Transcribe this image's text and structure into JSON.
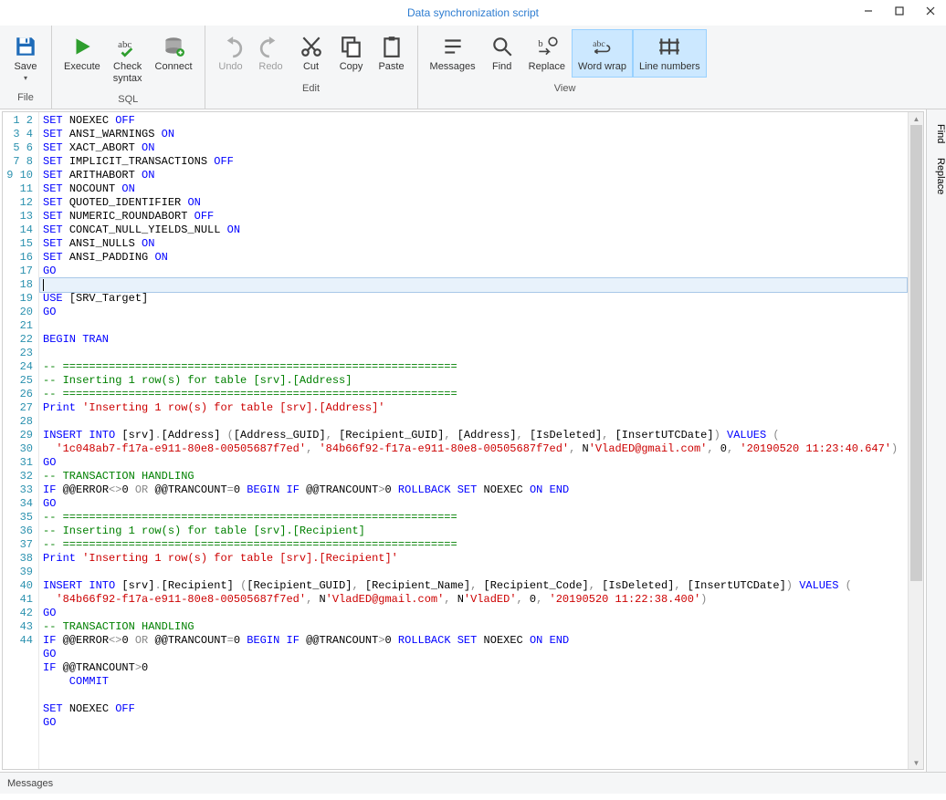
{
  "window": {
    "title": "Data synchronization script"
  },
  "ribbon": {
    "groups": {
      "file": {
        "label": "File",
        "save": "Save"
      },
      "sql": {
        "label": "SQL",
        "execute": "Execute",
        "check": "Check\nsyntax",
        "connect": "Connect"
      },
      "edit": {
        "label": "Edit",
        "undo": "Undo",
        "redo": "Redo",
        "cut": "Cut",
        "copy": "Copy",
        "paste": "Paste"
      },
      "view": {
        "label": "View",
        "messages": "Messages",
        "find": "Find",
        "replace": "Replace",
        "wrap": "Word wrap",
        "lines": "Line numbers"
      }
    }
  },
  "side": {
    "find": "Find",
    "replace": "Replace"
  },
  "status": {
    "messages": "Messages"
  },
  "code": {
    "lines": [
      {
        "n": 1,
        "tokens": [
          {
            "t": "SET ",
            "c": "kw"
          },
          {
            "t": "NOEXEC ",
            "c": "id"
          },
          {
            "t": "OFF",
            "c": "kw"
          }
        ]
      },
      {
        "n": 2,
        "tokens": [
          {
            "t": "SET ",
            "c": "kw"
          },
          {
            "t": "ANSI_WARNINGS ",
            "c": "id"
          },
          {
            "t": "ON",
            "c": "kw"
          }
        ]
      },
      {
        "n": 3,
        "tokens": [
          {
            "t": "SET ",
            "c": "kw"
          },
          {
            "t": "XACT_ABORT ",
            "c": "id"
          },
          {
            "t": "ON",
            "c": "kw"
          }
        ]
      },
      {
        "n": 4,
        "tokens": [
          {
            "t": "SET ",
            "c": "kw"
          },
          {
            "t": "IMPLICIT_TRANSACTIONS ",
            "c": "id"
          },
          {
            "t": "OFF",
            "c": "kw"
          }
        ]
      },
      {
        "n": 5,
        "tokens": [
          {
            "t": "SET ",
            "c": "kw"
          },
          {
            "t": "ARITHABORT ",
            "c": "id"
          },
          {
            "t": "ON",
            "c": "kw"
          }
        ]
      },
      {
        "n": 6,
        "tokens": [
          {
            "t": "SET ",
            "c": "kw"
          },
          {
            "t": "NOCOUNT ",
            "c": "id"
          },
          {
            "t": "ON",
            "c": "kw"
          }
        ]
      },
      {
        "n": 7,
        "tokens": [
          {
            "t": "SET ",
            "c": "kw"
          },
          {
            "t": "QUOTED_IDENTIFIER ",
            "c": "id"
          },
          {
            "t": "ON",
            "c": "kw"
          }
        ]
      },
      {
        "n": 8,
        "tokens": [
          {
            "t": "SET ",
            "c": "kw"
          },
          {
            "t": "NUMERIC_ROUNDABORT ",
            "c": "id"
          },
          {
            "t": "OFF",
            "c": "kw"
          }
        ]
      },
      {
        "n": 9,
        "tokens": [
          {
            "t": "SET ",
            "c": "kw"
          },
          {
            "t": "CONCAT_NULL_YIELDS_NULL ",
            "c": "id"
          },
          {
            "t": "ON",
            "c": "kw"
          }
        ]
      },
      {
        "n": 10,
        "tokens": [
          {
            "t": "SET ",
            "c": "kw"
          },
          {
            "t": "ANSI_NULLS ",
            "c": "id"
          },
          {
            "t": "ON",
            "c": "kw"
          }
        ]
      },
      {
        "n": 11,
        "tokens": [
          {
            "t": "SET ",
            "c": "kw"
          },
          {
            "t": "ANSI_PADDING ",
            "c": "id"
          },
          {
            "t": "ON",
            "c": "kw"
          }
        ]
      },
      {
        "n": 12,
        "tokens": [
          {
            "t": "GO",
            "c": "kw"
          }
        ]
      },
      {
        "n": 13,
        "selected": true,
        "tokens": []
      },
      {
        "n": 14,
        "tokens": [
          {
            "t": "USE ",
            "c": "kw"
          },
          {
            "t": "[SRV_Target]",
            "c": "id"
          }
        ]
      },
      {
        "n": 15,
        "tokens": [
          {
            "t": "GO",
            "c": "kw"
          }
        ]
      },
      {
        "n": 16,
        "tokens": []
      },
      {
        "n": 17,
        "tokens": [
          {
            "t": "BEGIN TRAN",
            "c": "kw"
          }
        ]
      },
      {
        "n": 18,
        "tokens": []
      },
      {
        "n": 19,
        "tokens": [
          {
            "t": "-- ============================================================",
            "c": "cmt"
          }
        ]
      },
      {
        "n": 20,
        "tokens": [
          {
            "t": "-- Inserting 1 row(s) for table [srv].[Address]",
            "c": "cmt"
          }
        ]
      },
      {
        "n": 21,
        "tokens": [
          {
            "t": "-- ============================================================",
            "c": "cmt"
          }
        ]
      },
      {
        "n": 22,
        "tokens": [
          {
            "t": "Print ",
            "c": "kw"
          },
          {
            "t": "'Inserting 1 row(s) for table [srv].[Address]'",
            "c": "str"
          }
        ]
      },
      {
        "n": 23,
        "tokens": []
      },
      {
        "n": 24,
        "tokens": [
          {
            "t": "INSERT INTO ",
            "c": "kw"
          },
          {
            "t": "[srv]",
            "c": "id"
          },
          {
            "t": ".",
            "c": "gray"
          },
          {
            "t": "[Address] ",
            "c": "id"
          },
          {
            "t": "(",
            "c": "gray"
          },
          {
            "t": "[Address_GUID]",
            "c": "id"
          },
          {
            "t": ", ",
            "c": "gray"
          },
          {
            "t": "[Recipient_GUID]",
            "c": "id"
          },
          {
            "t": ", ",
            "c": "gray"
          },
          {
            "t": "[Address]",
            "c": "id"
          },
          {
            "t": ", ",
            "c": "gray"
          },
          {
            "t": "[IsDeleted]",
            "c": "id"
          },
          {
            "t": ", ",
            "c": "gray"
          },
          {
            "t": "[InsertUTCDate]",
            "c": "id"
          },
          {
            "t": ") ",
            "c": "gray"
          },
          {
            "t": "VALUES ",
            "c": "kw"
          },
          {
            "t": "(",
            "c": "gray"
          }
        ]
      },
      {
        "n": 0,
        "indent": "  ",
        "tokens": [
          {
            "t": "'1c048ab7-f17a-e911-80e8-00505687f7ed'",
            "c": "str"
          },
          {
            "t": ", ",
            "c": "gray"
          },
          {
            "t": "'84b66f92-f17a-e911-80e8-00505687f7ed'",
            "c": "str"
          },
          {
            "t": ", ",
            "c": "gray"
          },
          {
            "t": "N",
            "c": "id"
          },
          {
            "t": "'VladED@gmail.com'",
            "c": "str"
          },
          {
            "t": ", ",
            "c": "gray"
          },
          {
            "t": "0",
            "c": "num"
          },
          {
            "t": ", ",
            "c": "gray"
          },
          {
            "t": "'20190520 11:23:40.647'",
            "c": "str"
          },
          {
            "t": ")",
            "c": "gray"
          }
        ]
      },
      {
        "n": 25,
        "tokens": [
          {
            "t": "GO",
            "c": "kw"
          }
        ]
      },
      {
        "n": 26,
        "tokens": [
          {
            "t": "-- TRANSACTION HANDLING",
            "c": "cmt"
          }
        ]
      },
      {
        "n": 27,
        "tokens": [
          {
            "t": "IF ",
            "c": "kw"
          },
          {
            "t": "@@ERROR",
            "c": "id"
          },
          {
            "t": "<>",
            "c": "gray"
          },
          {
            "t": "0 ",
            "c": "num"
          },
          {
            "t": "OR ",
            "c": "gray"
          },
          {
            "t": "@@TRANCOUNT",
            "c": "id"
          },
          {
            "t": "=",
            "c": "gray"
          },
          {
            "t": "0 ",
            "c": "num"
          },
          {
            "t": "BEGIN IF ",
            "c": "kw"
          },
          {
            "t": "@@TRANCOUNT",
            "c": "id"
          },
          {
            "t": ">",
            "c": "gray"
          },
          {
            "t": "0 ",
            "c": "num"
          },
          {
            "t": "ROLLBACK SET ",
            "c": "kw"
          },
          {
            "t": "NOEXEC ",
            "c": "id"
          },
          {
            "t": "ON END",
            "c": "kw"
          }
        ]
      },
      {
        "n": 28,
        "tokens": [
          {
            "t": "GO",
            "c": "kw"
          }
        ]
      },
      {
        "n": 29,
        "tokens": [
          {
            "t": "-- ============================================================",
            "c": "cmt"
          }
        ]
      },
      {
        "n": 30,
        "tokens": [
          {
            "t": "-- Inserting 1 row(s) for table [srv].[Recipient]",
            "c": "cmt"
          }
        ]
      },
      {
        "n": 31,
        "tokens": [
          {
            "t": "-- ============================================================",
            "c": "cmt"
          }
        ]
      },
      {
        "n": 32,
        "tokens": [
          {
            "t": "Print ",
            "c": "kw"
          },
          {
            "t": "'Inserting 1 row(s) for table [srv].[Recipient]'",
            "c": "str"
          }
        ]
      },
      {
        "n": 33,
        "tokens": []
      },
      {
        "n": 34,
        "tokens": [
          {
            "t": "INSERT INTO ",
            "c": "kw"
          },
          {
            "t": "[srv]",
            "c": "id"
          },
          {
            "t": ".",
            "c": "gray"
          },
          {
            "t": "[Recipient] ",
            "c": "id"
          },
          {
            "t": "(",
            "c": "gray"
          },
          {
            "t": "[Recipient_GUID]",
            "c": "id"
          },
          {
            "t": ", ",
            "c": "gray"
          },
          {
            "t": "[Recipient_Name]",
            "c": "id"
          },
          {
            "t": ", ",
            "c": "gray"
          },
          {
            "t": "[Recipient_Code]",
            "c": "id"
          },
          {
            "t": ", ",
            "c": "gray"
          },
          {
            "t": "[IsDeleted]",
            "c": "id"
          },
          {
            "t": ", ",
            "c": "gray"
          },
          {
            "t": "[InsertUTCDate]",
            "c": "id"
          },
          {
            "t": ") ",
            "c": "gray"
          },
          {
            "t": "VALUES ",
            "c": "kw"
          },
          {
            "t": "(",
            "c": "gray"
          }
        ]
      },
      {
        "n": 0,
        "indent": "  ",
        "tokens": [
          {
            "t": "'84b66f92-f17a-e911-80e8-00505687f7ed'",
            "c": "str"
          },
          {
            "t": ", ",
            "c": "gray"
          },
          {
            "t": "N",
            "c": "id"
          },
          {
            "t": "'VladED@gmail.com'",
            "c": "str"
          },
          {
            "t": ", ",
            "c": "gray"
          },
          {
            "t": "N",
            "c": "id"
          },
          {
            "t": "'VladED'",
            "c": "str"
          },
          {
            "t": ", ",
            "c": "gray"
          },
          {
            "t": "0",
            "c": "num"
          },
          {
            "t": ", ",
            "c": "gray"
          },
          {
            "t": "'20190520 11:22:38.400'",
            "c": "str"
          },
          {
            "t": ")",
            "c": "gray"
          }
        ]
      },
      {
        "n": 35,
        "tokens": [
          {
            "t": "GO",
            "c": "kw"
          }
        ]
      },
      {
        "n": 36,
        "tokens": [
          {
            "t": "-- TRANSACTION HANDLING",
            "c": "cmt"
          }
        ]
      },
      {
        "n": 37,
        "tokens": [
          {
            "t": "IF ",
            "c": "kw"
          },
          {
            "t": "@@ERROR",
            "c": "id"
          },
          {
            "t": "<>",
            "c": "gray"
          },
          {
            "t": "0 ",
            "c": "num"
          },
          {
            "t": "OR ",
            "c": "gray"
          },
          {
            "t": "@@TRANCOUNT",
            "c": "id"
          },
          {
            "t": "=",
            "c": "gray"
          },
          {
            "t": "0 ",
            "c": "num"
          },
          {
            "t": "BEGIN IF ",
            "c": "kw"
          },
          {
            "t": "@@TRANCOUNT",
            "c": "id"
          },
          {
            "t": ">",
            "c": "gray"
          },
          {
            "t": "0 ",
            "c": "num"
          },
          {
            "t": "ROLLBACK SET ",
            "c": "kw"
          },
          {
            "t": "NOEXEC ",
            "c": "id"
          },
          {
            "t": "ON END",
            "c": "kw"
          }
        ]
      },
      {
        "n": 38,
        "tokens": [
          {
            "t": "GO",
            "c": "kw"
          }
        ]
      },
      {
        "n": 39,
        "tokens": [
          {
            "t": "IF ",
            "c": "kw"
          },
          {
            "t": "@@TRANCOUNT",
            "c": "id"
          },
          {
            "t": ">",
            "c": "gray"
          },
          {
            "t": "0",
            "c": "num"
          }
        ]
      },
      {
        "n": 40,
        "tokens": [
          {
            "t": "    COMMIT",
            "c": "kw"
          }
        ]
      },
      {
        "n": 41,
        "tokens": []
      },
      {
        "n": 42,
        "tokens": [
          {
            "t": "SET ",
            "c": "kw"
          },
          {
            "t": "NOEXEC ",
            "c": "id"
          },
          {
            "t": "OFF",
            "c": "kw"
          }
        ]
      },
      {
        "n": 43,
        "tokens": [
          {
            "t": "GO",
            "c": "kw"
          }
        ]
      },
      {
        "n": 44,
        "tokens": []
      }
    ]
  }
}
